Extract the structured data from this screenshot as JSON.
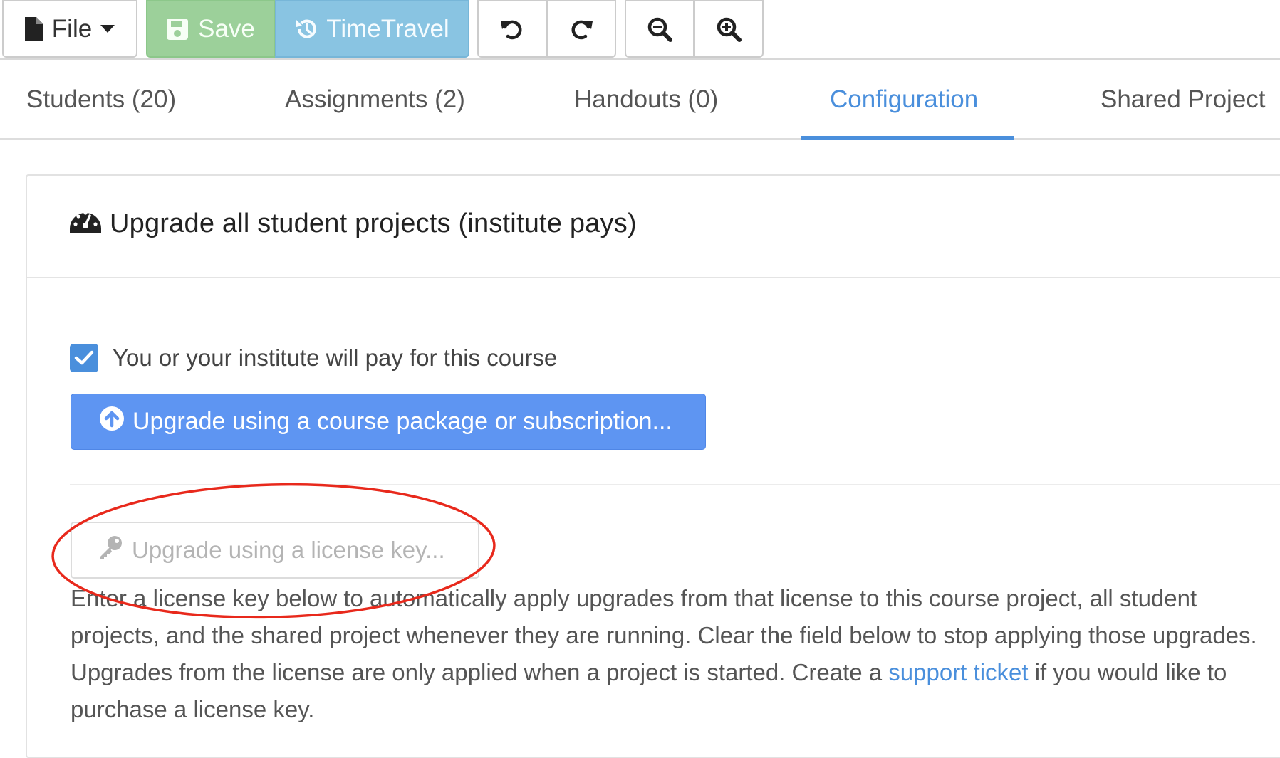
{
  "toolbar": {
    "file_label": "File",
    "save_label": "Save",
    "timetravel_label": "TimeTravel"
  },
  "tabs": [
    {
      "label": "Students (20)",
      "active": false
    },
    {
      "label": "Assignments (2)",
      "active": false
    },
    {
      "label": "Handouts (0)",
      "active": false
    },
    {
      "label": "Configuration",
      "active": true
    },
    {
      "label": "Shared Project",
      "active": false
    }
  ],
  "panel": {
    "title": "Upgrade all student projects (institute pays)",
    "checkbox_label": "You or your institute will pay for this course",
    "checkbox_checked": true,
    "upgrade_button_label": "Upgrade using a course package or subscription...",
    "license_button_label": "Upgrade using a license key...",
    "description_before_link": "Enter a license key below to automatically apply upgrades from that license to this course project, all student projects, and the shared project whenever they are running. Clear the field below to stop applying those upgrades. Upgrades from the license are only applied when a project is started. Create a ",
    "description_link": "support ticket",
    "description_after_link": " if you would like to purchase a license key."
  },
  "colors": {
    "accent": "#4a8fdc",
    "save_bg": "#9cd09a",
    "timetravel_bg": "#89c4e2",
    "primary_button": "#5e95f2",
    "annotation_ellipse": "#e8291c"
  },
  "icons": {
    "file": "file-icon",
    "caret": "caret-down-icon",
    "save": "floppy-disk-icon",
    "timetravel": "history-icon",
    "undo": "undo-icon",
    "redo": "redo-icon",
    "zoom_out": "zoom-out-icon",
    "zoom_in": "zoom-in-icon",
    "dashboard": "dashboard-gauge-icon",
    "check": "check-icon",
    "arrow_up_circle": "arrow-circle-up-icon",
    "key": "key-icon"
  }
}
